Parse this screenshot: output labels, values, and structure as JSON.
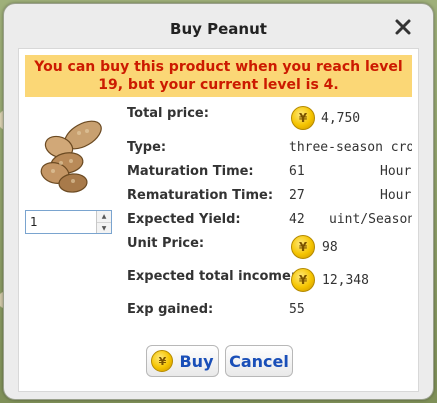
{
  "dialog": {
    "title": "Buy Peanut",
    "warning": "You can buy this product when you reach level 19, but your current level is 4.",
    "quantity": "1",
    "labels": {
      "total_price": "Total price:",
      "type": "Type:",
      "maturation": "Maturation Time:",
      "rematuration": "Rematuration Time:",
      "yield": "Expected Yield:",
      "unit_price": "Unit Price:",
      "income": "Expected total income:",
      "exp": "Exp gained:"
    },
    "values": {
      "total_price": "4,750",
      "type": "three-season crop",
      "maturation": "61",
      "maturation_unit": "Hour",
      "rematuration": "27",
      "rematuration_unit": "Hour",
      "yield": "42",
      "yield_unit": "uint/Season",
      "unit_price": "98",
      "income": "12,348",
      "exp": "55"
    },
    "currency_symbol": "¥",
    "buttons": {
      "buy": "Buy",
      "cancel": "Cancel"
    },
    "icons": {
      "close": "close-icon",
      "coin": "coin-icon",
      "product": "peanut-icon"
    },
    "colors": {
      "warning_bg": "#fbd776",
      "warning_text": "#cc1a00",
      "button_text": "#1a4fb8",
      "coin": "#f5c400"
    }
  }
}
